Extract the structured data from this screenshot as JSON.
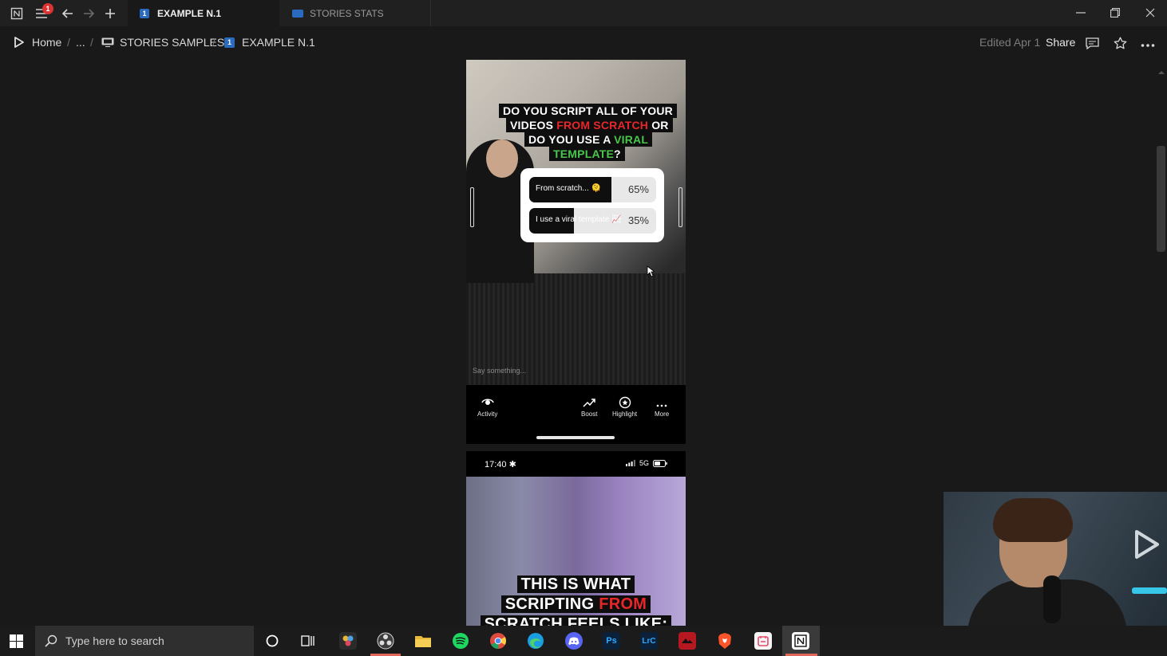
{
  "titlebar": {
    "notification_count": "1",
    "tabs": [
      {
        "number": "1",
        "label": "EXAMPLE N.1",
        "active": true
      },
      {
        "label": "STORIES STATS",
        "active": false
      }
    ]
  },
  "breadcrumb": {
    "home": "Home",
    "ellipsis": "...",
    "separator": "/",
    "items": [
      "STORIES SAMPLES",
      "EXAMPLE N.1"
    ],
    "item_number": "1"
  },
  "toolbar": {
    "edited": "Edited Apr 1",
    "share": "Share"
  },
  "story1": {
    "question_lines": [
      [
        "DO YOU SCRIPT ALL OF YOUR"
      ],
      [
        "VIDEOS ",
        "FROM SCRATCH",
        " OR"
      ],
      [
        "DO YOU USE A ",
        "VIRAL"
      ],
      [
        "TEMPLATE",
        "?"
      ]
    ],
    "q_line1": "DO YOU SCRIPT ALL OF YOUR",
    "q_line2_a": "VIDEOS ",
    "q_line2_b": "FROM SCRATCH",
    "q_line2_c": " OR",
    "q_line3_a": "DO YOU USE A ",
    "q_line3_b": "VIRAL",
    "q_line4_a": "TEMPLATE",
    "q_line4_b": "?",
    "poll": {
      "options": [
        {
          "label": "From scratch... 🫠",
          "percent": "65%",
          "fraction": 0.65
        },
        {
          "label": "I use a viral template 📈",
          "percent": "35%",
          "fraction": 0.35
        }
      ]
    },
    "comment_placeholder": "Say something...",
    "actions": [
      {
        "icon": "activity-icon",
        "label": "Activity"
      },
      {
        "icon": "boost-icon",
        "label": "Boost"
      },
      {
        "icon": "highlight-icon",
        "label": "Highlight"
      },
      {
        "icon": "more-icon",
        "label": "More"
      }
    ]
  },
  "story2": {
    "time": "17:40",
    "signal": "5G",
    "line1": "THIS IS WHAT",
    "line2_a": "SCRIPTING ",
    "line2_b": "FROM",
    "line3": "SCRATCH FEELS LIKE:"
  },
  "taskbar": {
    "search_placeholder": "Type here to search",
    "apps": [
      "cortana",
      "task-view",
      "davinci-resolve",
      "obs",
      "file-explorer",
      "spotify",
      "chrome",
      "edge",
      "discord",
      "photoshop",
      "lightroom-classic",
      "app-red",
      "brave",
      "app-calendar",
      "notion"
    ],
    "ps_label": "Ps",
    "lrc_label": "LrC"
  },
  "colors": {
    "accent_red": "#e8262a",
    "accent_green": "#49c64b",
    "tab_blue": "#2a6bbf"
  }
}
